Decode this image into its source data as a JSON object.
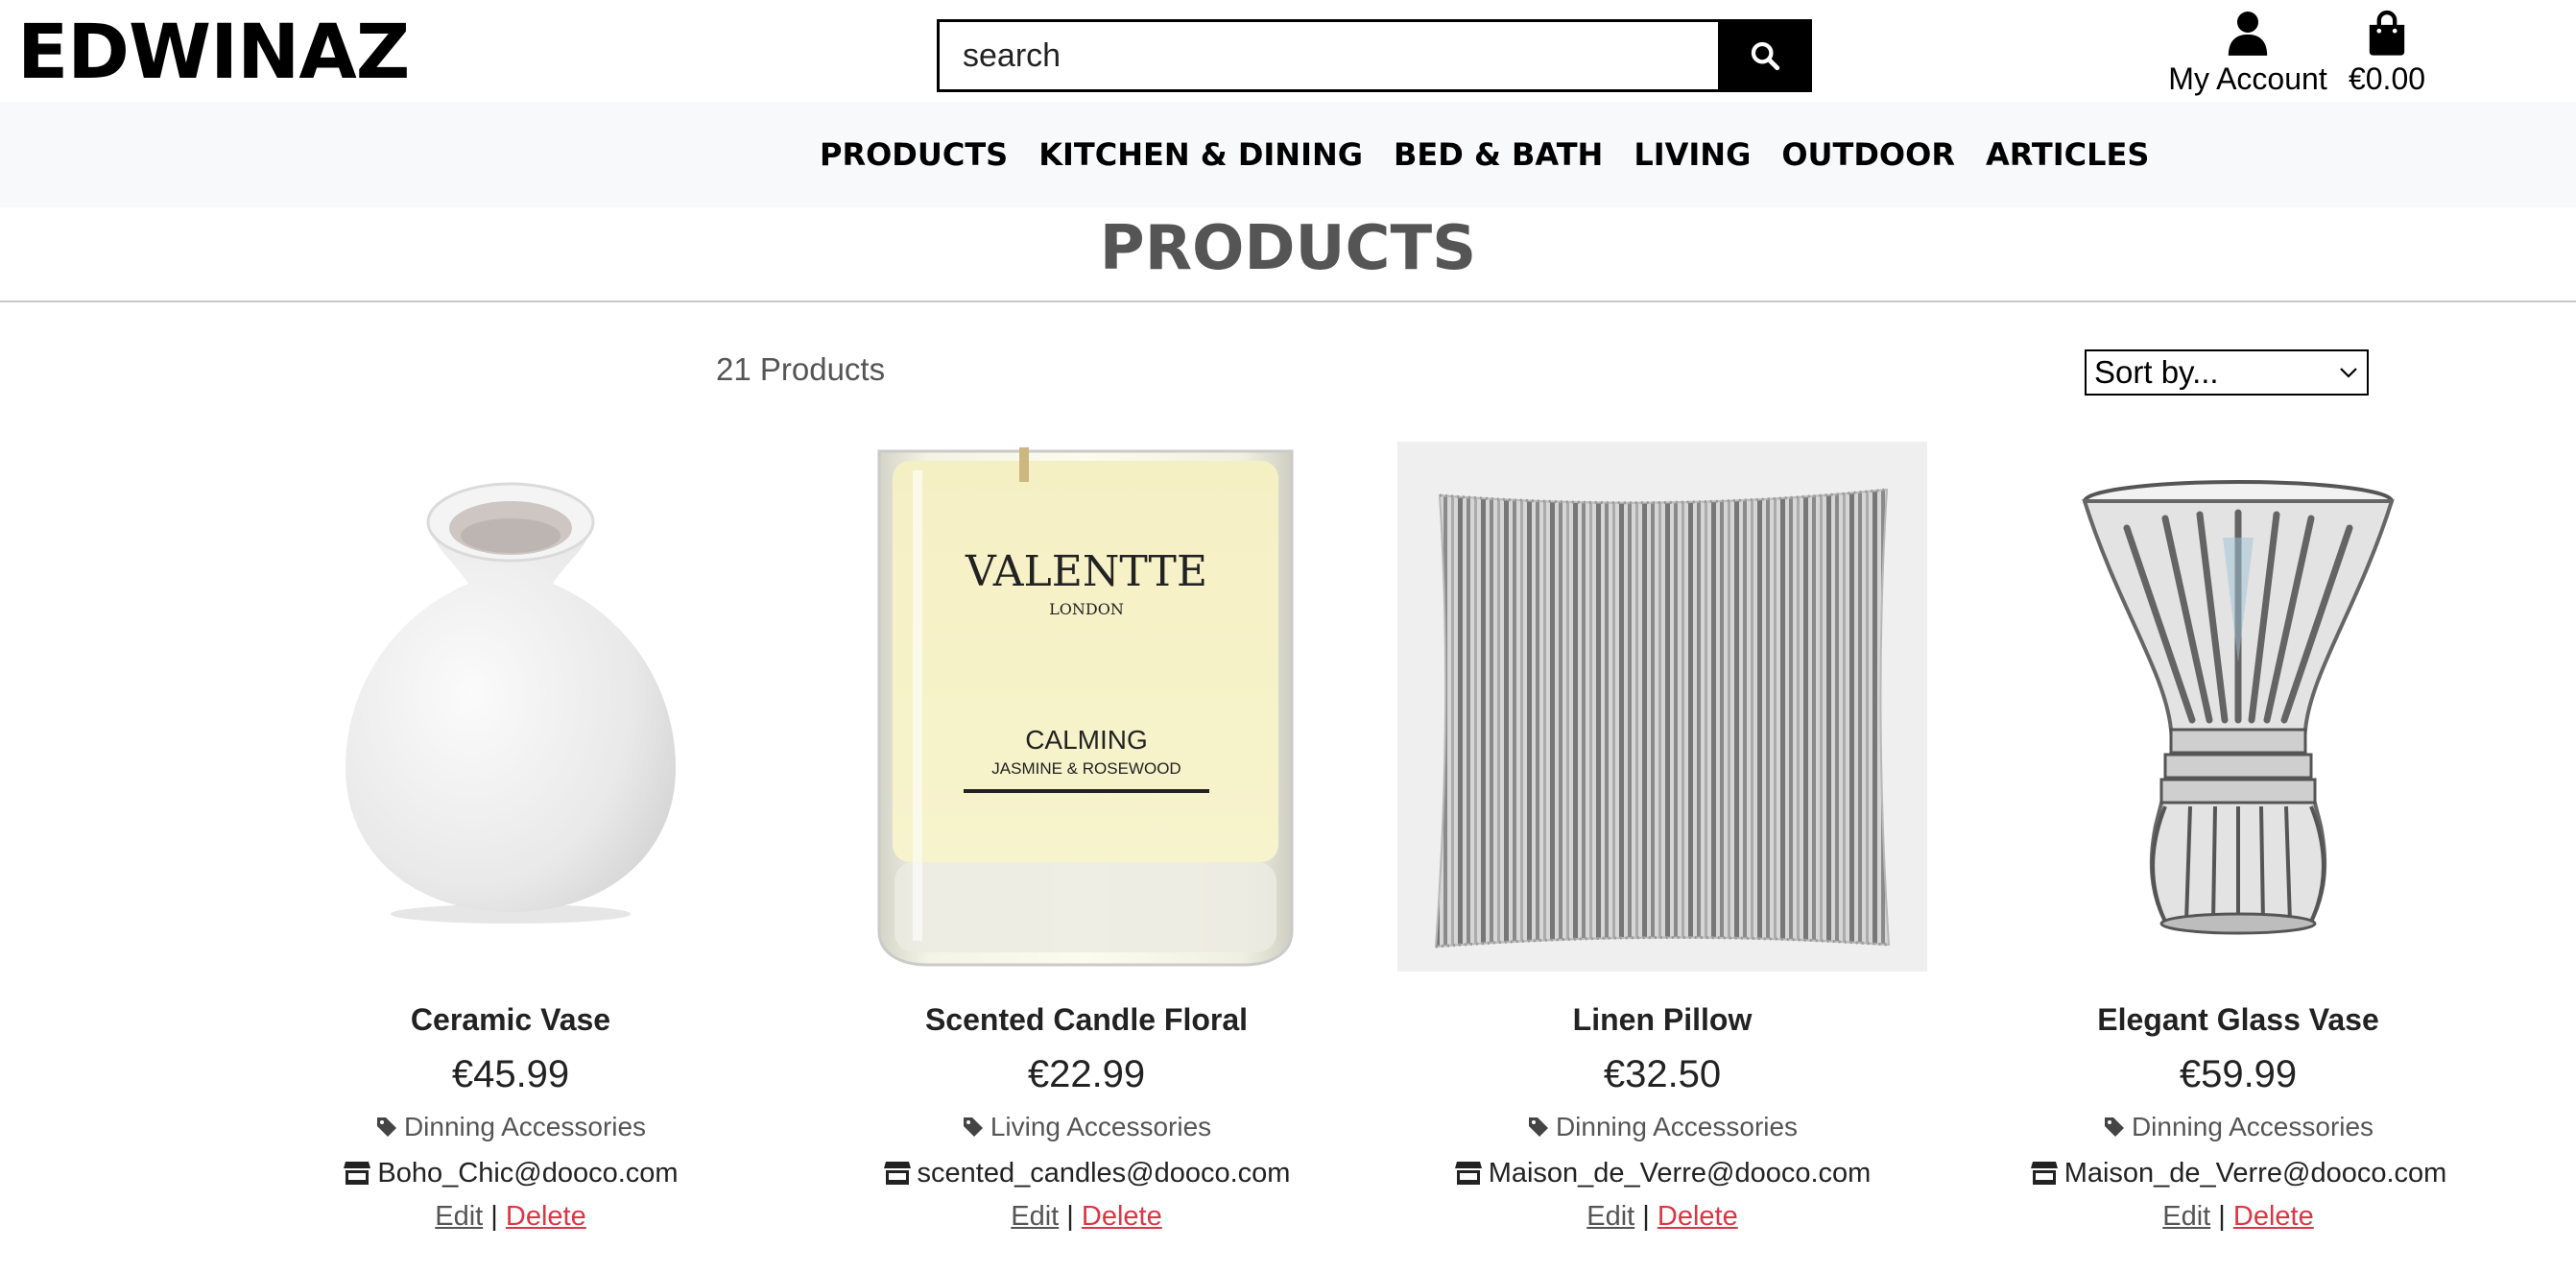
{
  "brand": {
    "logo_text": "EDWINAZ"
  },
  "search": {
    "placeholder": "search"
  },
  "header": {
    "account_label": "My Account",
    "bag_total": "€0.00"
  },
  "nav": {
    "items": [
      "PRODUCTS",
      "KITCHEN & DINING",
      "BED & BATH",
      "LIVING",
      "OUTDOOR",
      "ARTICLES"
    ]
  },
  "page": {
    "title": "PRODUCTS",
    "count_text": "21 Products",
    "sort_label": "Sort by..."
  },
  "products": [
    {
      "name": "Ceramic Vase",
      "price": "€45.99",
      "category": "Dinning Accessories",
      "seller": "Boho_Chic@dooco.com",
      "edit": "Edit",
      "separator": "|",
      "delete": "Delete",
      "image": "ceramic-vase"
    },
    {
      "name": "Scented Candle Floral",
      "price": "€22.99",
      "category": "Living Accessories",
      "seller": "scented_candles@dooco.com",
      "edit": "Edit",
      "separator": "|",
      "delete": "Delete",
      "image": "candle",
      "label_brand": "VALENTTE",
      "label_city": "LONDON",
      "label_scent": "CALMING",
      "label_notes": "JASMINE & ROSEWOOD"
    },
    {
      "name": "Linen Pillow",
      "price": "€32.50",
      "category": "Dinning Accessories",
      "seller": "Maison_de_Verre@dooco.com",
      "edit": "Edit",
      "separator": "|",
      "delete": "Delete",
      "image": "linen-pillow"
    },
    {
      "name": "Elegant Glass Vase",
      "price": "€59.99",
      "category": "Dinning Accessories",
      "seller": "Maison_de_Verre@dooco.com",
      "edit": "Edit",
      "separator": "|",
      "delete": "Delete",
      "image": "glass-vase"
    }
  ],
  "colors": {
    "delete": "#dc3545",
    "nav_bg": "#f8f9fa",
    "title": "#555555"
  }
}
